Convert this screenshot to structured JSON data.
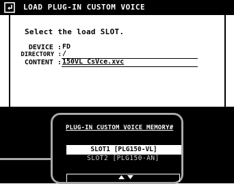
{
  "window": {
    "title": "LOAD PLUG-IN CUSTOM VOICE",
    "icon": "back-arrow-icon"
  },
  "main": {
    "prompt": "Select the load SLOT.",
    "fields": [
      {
        "label": "DEVICE :",
        "value": "FD"
      },
      {
        "label": "DIRECTORY :",
        "value": "/"
      },
      {
        "label": "CONTENT :",
        "value": "150VL CsVce.xvc"
      }
    ]
  },
  "memory_panel": {
    "title": "PLUG-IN CUSTOM VOICE MEMORY#",
    "slots": [
      {
        "label": "SLOT1 [PLG150-VL]",
        "selected": true
      },
      {
        "label": "SLOT2 [PLG150-AN]",
        "selected": false
      }
    ],
    "scroll_icon": "up-down-arrows-icon"
  },
  "colors": {
    "background": "#ffffff",
    "bar": "#000000",
    "highlight_border": "#a9a9a9"
  }
}
